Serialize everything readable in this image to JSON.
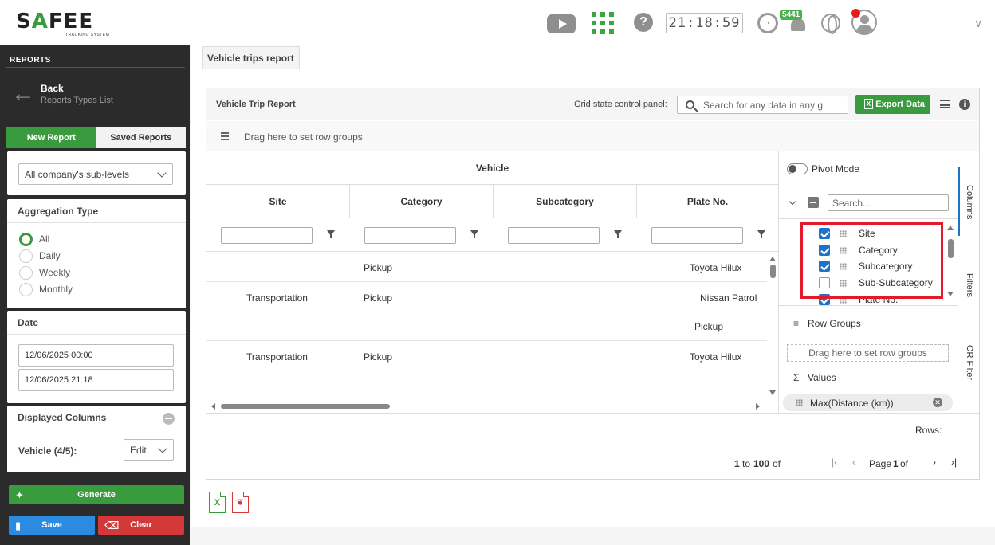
{
  "header": {
    "logo_text_1": "S",
    "logo_text_2": "A",
    "logo_text_3": "FEE",
    "logo_sub": "TRACKING SYSTEM",
    "help_glyph": "?",
    "clock": "21:18:59",
    "speed_glyph": "◔",
    "notifications_count": "5441",
    "chevron": "∨"
  },
  "sidebar": {
    "heading": "REPORTS",
    "back_label": "Back",
    "back_sub": "Reports Types List",
    "back_arrow": "←",
    "tabs": [
      "New Report",
      "Saved Reports"
    ],
    "levels_select": "All company's sub-levels",
    "aggregation": {
      "title": "Aggregation Type",
      "options": [
        "All",
        "Daily",
        "Weekly",
        "Monthly"
      ],
      "selected": "All"
    },
    "date": {
      "title": "Date",
      "from": "12/06/2025 00:00",
      "to": "12/06/2025 21:18"
    },
    "displayed_columns": {
      "title": "Displayed Columns",
      "vehicle_label": "Vehicle (4/5):",
      "edit_select": "Edit"
    },
    "buttons": {
      "generate": "Generate",
      "save": "Save",
      "clear": "Clear"
    },
    "colors": {
      "green": "#3a9a3e",
      "blue": "#2a8be0",
      "red": "#d43838"
    }
  },
  "main": {
    "tab_label": "Vehicle trips report",
    "panel_title": "Vehicle Trip Report",
    "grid_state_label": "Grid state control panel:",
    "search_placeholder": "Search for any data in any g",
    "export_label": "Export Data",
    "info_glyph": "i",
    "row_group_hint": "Drag here to set row groups",
    "group_header": "Vehicle",
    "columns": [
      "Site",
      "Category",
      "Subcategory",
      "Plate No."
    ],
    "rows": [
      {
        "site": "",
        "category": "Pickup",
        "subcategory": "",
        "plate": "Toyota Hilux",
        "extra": ""
      },
      {
        "site": "Transportation",
        "category": "Pickup",
        "subcategory": "",
        "plate": "Nissan Patrol",
        "extra": "Pickup"
      },
      {
        "site": "Transportation",
        "category": "Pickup",
        "subcategory": "",
        "plate": "Toyota Hilux",
        "extra": ""
      }
    ],
    "side_panel": {
      "pivot_label": "Pivot Mode",
      "search_placeholder": "Search...",
      "column_items": [
        {
          "label": "Site",
          "checked": true
        },
        {
          "label": "Category",
          "checked": true
        },
        {
          "label": "Subcategory",
          "checked": true
        },
        {
          "label": "Sub-Subcategory",
          "checked": false
        },
        {
          "label": "Plate No.",
          "checked": true
        }
      ],
      "row_groups_title": "Row Groups",
      "row_groups_hint": "Drag here to set row groups",
      "values_title": "Values",
      "values_sigma": "Σ",
      "value_chip": "Max(Distance (km))",
      "chip_close": "✕"
    },
    "rail_tabs": [
      "Columns",
      "Filters",
      "OR Filter"
    ],
    "rows_label": "Rows:",
    "pager": {
      "range_start": "1",
      "range_to": "to",
      "range_end": "100",
      "range_of": "of",
      "page_label": "Page",
      "page_number": "1",
      "page_of": "of",
      "first": "|‹",
      "prev": "‹",
      "next": "›",
      "last": "›|"
    },
    "file_excel": "X",
    "file_pdf": "❦"
  }
}
